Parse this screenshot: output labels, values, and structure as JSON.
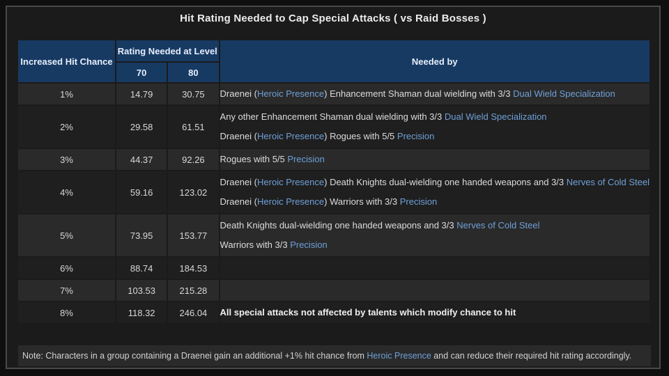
{
  "title": "Hit Rating Needed to Cap Special Attacks ( vs Raid Bosses )",
  "headers": {
    "col1": "Increased Hit Chance",
    "group": "Rating Needed at Level",
    "lvl70": "70",
    "lvl80": "80",
    "needed": "Needed by"
  },
  "rows": [
    {
      "pct": "1%",
      "r70": "14.79",
      "r80": "30.75",
      "lines": [
        [
          {
            "t": "Draenei ("
          },
          {
            "t": "Heroic Presence",
            "link": true
          },
          {
            "t": ") Enhancement Shaman dual wielding with 3/3 "
          },
          {
            "t": "Dual Wield Specialization",
            "link": true
          }
        ]
      ]
    },
    {
      "pct": "2%",
      "r70": "29.58",
      "r80": "61.51",
      "lines": [
        [
          {
            "t": "Any other Enhancement Shaman dual wielding with 3/3 "
          },
          {
            "t": "Dual Wield Specialization",
            "link": true
          }
        ],
        [
          {
            "t": "Draenei ("
          },
          {
            "t": "Heroic Presence",
            "link": true
          },
          {
            "t": ") Rogues with 5/5 "
          },
          {
            "t": "Precision",
            "link": true
          }
        ]
      ]
    },
    {
      "pct": "3%",
      "r70": "44.37",
      "r80": "92.26",
      "lines": [
        [
          {
            "t": "Rogues with 5/5 "
          },
          {
            "t": "Precision",
            "link": true
          }
        ]
      ]
    },
    {
      "pct": "4%",
      "r70": "59.16",
      "r80": "123.02",
      "lines": [
        [
          {
            "t": "Draenei ("
          },
          {
            "t": "Heroic Presence",
            "link": true
          },
          {
            "t": ") Death Knights dual-wielding one handed weapons and 3/3 "
          },
          {
            "t": "Nerves of Cold Steel",
            "link": true
          }
        ],
        [
          {
            "t": "Draenei ("
          },
          {
            "t": "Heroic Presence",
            "link": true
          },
          {
            "t": ") Warriors with 3/3 "
          },
          {
            "t": "Precision",
            "link": true
          }
        ]
      ]
    },
    {
      "pct": "5%",
      "r70": "73.95",
      "r80": "153.77",
      "lines": [
        [
          {
            "t": "Death Knights dual-wielding one handed weapons and 3/3 "
          },
          {
            "t": "Nerves of Cold Steel",
            "link": true
          }
        ],
        [
          {
            "t": "Warriors with 3/3 "
          },
          {
            "t": "Precision",
            "link": true
          }
        ]
      ]
    },
    {
      "pct": "6%",
      "r70": "88.74",
      "r80": "184.53",
      "lines": []
    },
    {
      "pct": "7%",
      "r70": "103.53",
      "r80": "215.28",
      "lines": []
    },
    {
      "pct": "8%",
      "r70": "118.32",
      "r80": "246.04",
      "lines": [
        [
          {
            "t": "All special attacks not affected by talents which modify chance to hit",
            "bold": true
          }
        ]
      ]
    }
  ],
  "note": [
    {
      "t": "Note: Characters in a group containing a Draenei gain an additional +1% hit chance from "
    },
    {
      "t": "Heroic Presence",
      "link": true
    },
    {
      "t": " and can reduce their required hit rating accordingly."
    }
  ]
}
